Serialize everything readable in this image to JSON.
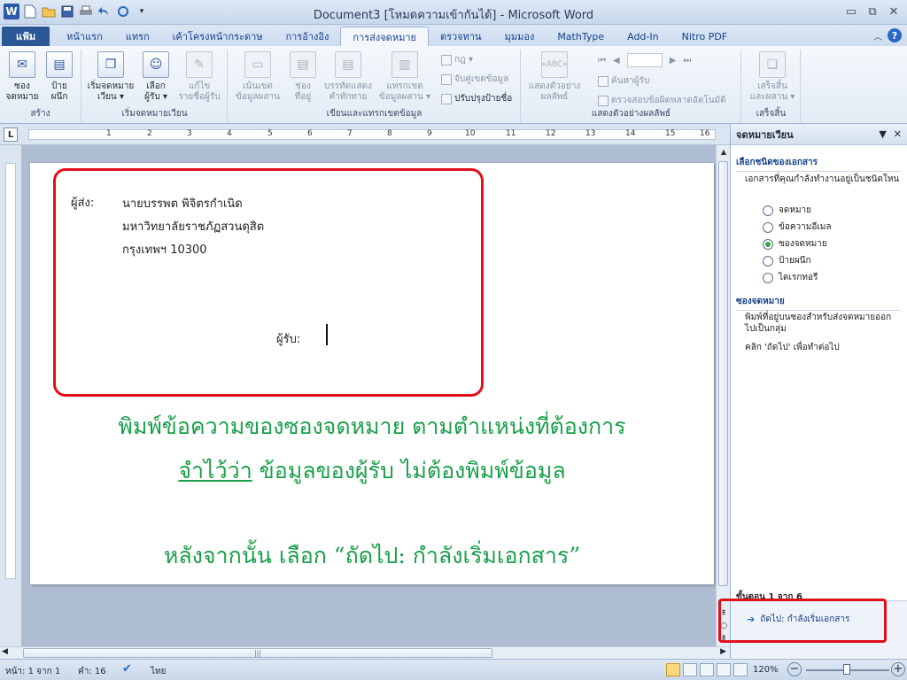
{
  "window": {
    "title": "Document3 [โหมดความเข้ากันได้] - Microsoft Word",
    "app_icon": "W",
    "controls": [
      "▭",
      "⧉",
      "✕"
    ]
  },
  "qat": {
    "save_icon": "save-icon",
    "undo_icon": "undo-icon",
    "redo_icon": "redo-icon"
  },
  "tabs": [
    {
      "label": "แฟ้ม"
    },
    {
      "label": "หน้าแรก"
    },
    {
      "label": "แทรก"
    },
    {
      "label": "เค้าโครงหน้ากระดาษ"
    },
    {
      "label": "การอ้างอิง"
    },
    {
      "label": "การส่งจดหมาย"
    },
    {
      "label": "ตรวจทาน"
    },
    {
      "label": "มุมมอง"
    },
    {
      "label": "MathType"
    },
    {
      "label": "Add-In"
    },
    {
      "label": "Nitro PDF"
    }
  ],
  "ribbon": {
    "create": {
      "label": "สร้าง",
      "envelopes": "ซอง\nจดหมาย",
      "labels": "ป้าย\nผนึก"
    },
    "start_merge": {
      "label": "เริ่มจดหมายเวียน",
      "start": "เริ่มจดหมาย\nเวียน ▾",
      "select": "เลือก\nผู้รับ ▾",
      "edit": "แก้ไข\nรายชื่อผู้รับ"
    },
    "write_insert": {
      "label": "เขียนและแทรกเขตข้อมูล",
      "highlight": "เน้นเขต\nข้อมูลผสาน",
      "address": "ช่อง\nที่อยู่",
      "greeting": "บรรทัดแสดง\nคำทักทาย",
      "insert": "แทรกเขต\nข้อมูลผสาน ▾",
      "rules": "กฎ ▾",
      "match": "จับคู่เขตข้อมูล",
      "update": "ปรับปรุงป้ายชื่อ"
    },
    "preview": {
      "label": "แสดงตัวอย่างผลลัพธ์",
      "preview_btn": "แสดงตัวอย่าง\nผลลัพธ์",
      "find": "ค้นหาผู้รับ",
      "check": "ตรวจสอบข้อผิดพลาดอัตโนมัติ"
    },
    "finish": {
      "label": "เสร็จสิ้น",
      "finish_btn": "เสร็จสิ้น\nและผสาน ▾"
    }
  },
  "ruler": {
    "corner": "L",
    "numbers": [
      "1",
      "2",
      "3",
      "4",
      "5",
      "6",
      "7",
      "8",
      "9",
      "10",
      "11",
      "12",
      "13",
      "14",
      "15",
      "16"
    ]
  },
  "document": {
    "sender_label": "ผู้ส่ง:",
    "sender_lines": [
      "นายบรรพต พิจิตรกำเนิด",
      "มหาวิทยาลัยราชภัฏสวนดุสิต",
      "กรุงเทพฯ 10300"
    ],
    "recipient_label": "ผู้รับ:",
    "instruction_1": "พิมพ์ข้อความของซองจดหมาย ตามตำแหน่งที่ต้องการ",
    "instruction_2_underlined": "จำไว้ว่า",
    "instruction_2_rest": " ข้อมูลของผู้รับ ไม่ต้องพิมพ์ข้อมูล",
    "instruction_3": "หลังจากนั้น เลือก “ถัดไป: กำลังเริ่มเอกสาร”"
  },
  "pane": {
    "title": "จดหมายเวียน",
    "section1": "เลือกชนิดของเอกสาร",
    "question": "เอกสารที่คุณกำลังทำงานอยู่เป็นชนิดใหน",
    "options": [
      {
        "label": "จดหมาย",
        "selected": false
      },
      {
        "label": "ข้อความอีเมล",
        "selected": false
      },
      {
        "label": "ซองจดหมาย",
        "selected": true
      },
      {
        "label": "ป้ายผนึก",
        "selected": false
      },
      {
        "label": "ไดเรกทอรี",
        "selected": false
      }
    ],
    "section2": "ซองจดหมาย",
    "desc": "พิมพ์ที่อยู่บนซองสำหรับส่งจดหมายออกไปเป็นกลุ่ม",
    "hint": "คลิก 'ถัดไป' เพื่อทำต่อไป",
    "step": "ขั้นตอน 1 จาก 6",
    "next": "ถัดไป: กำลังเริ่มเอกสาร"
  },
  "status": {
    "page": "หน้า: 1 จาก 1",
    "words": "คำ: 16",
    "language": "ไทย",
    "zoom": "120%"
  }
}
